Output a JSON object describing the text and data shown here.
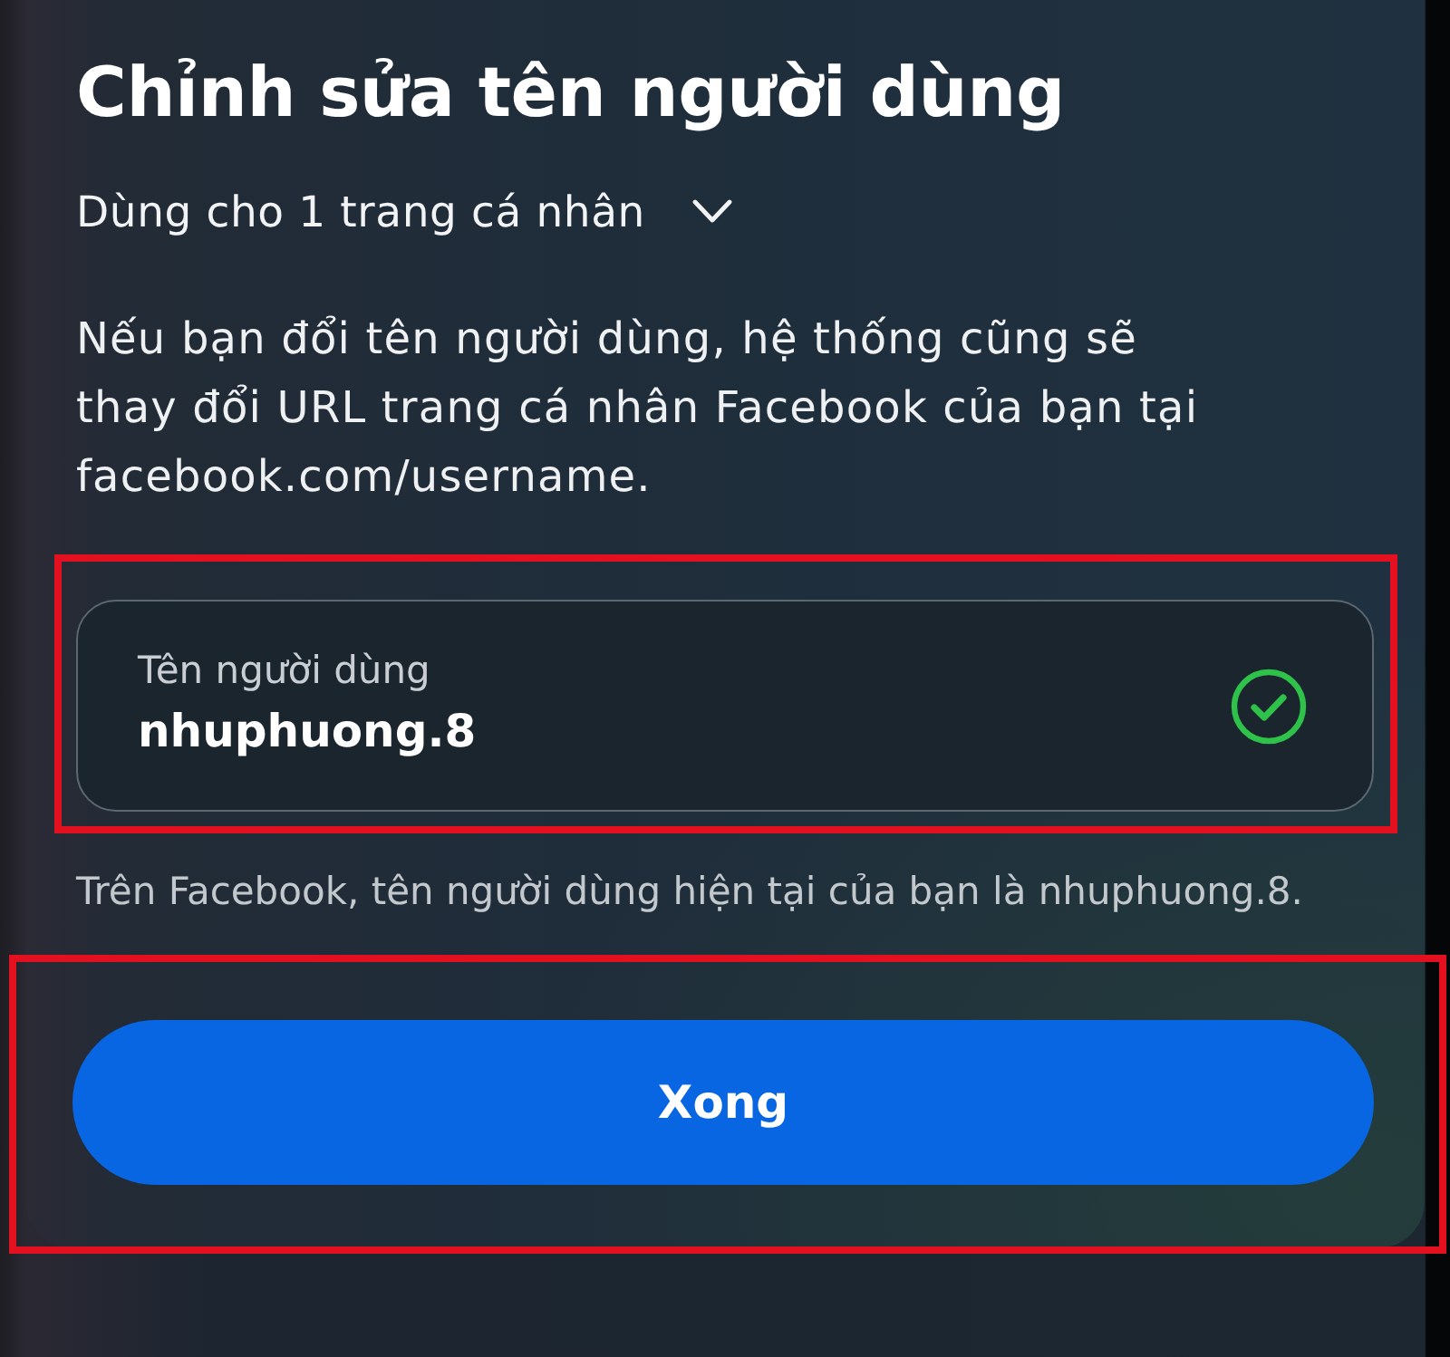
{
  "title": "Chỉnh sửa tên người dùng",
  "scope_dropdown": {
    "label": "Dùng cho 1 trang cá nhân"
  },
  "description": [
    "Nếu bạn đổi tên người dùng, hệ thống cũng sẽ",
    "thay đổi URL trang cá nhân Facebook của bạn tại",
    "facebook.com/username."
  ],
  "username_field": {
    "label": "Tên người dùng",
    "value": "nhuphuong.8",
    "valid": true,
    "highlighted": true
  },
  "helper_text": "Trên Facebook, tên người dùng hiện tại của bạn là nhuphuong.8.",
  "done_button": {
    "label": "Xong",
    "highlighted": true
  }
}
